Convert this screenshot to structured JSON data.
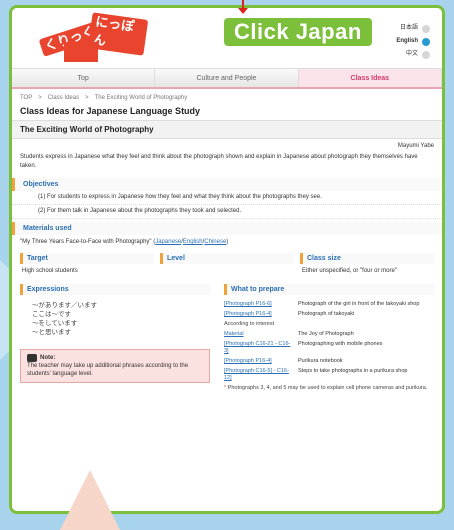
{
  "header": {
    "logo_text_1": "くりっく",
    "logo_text_2": "にっぽん",
    "brand": "Click Japan",
    "languages": [
      {
        "label": "日本語",
        "active": false
      },
      {
        "label": "English",
        "active": true
      },
      {
        "label": "中文",
        "active": false
      }
    ]
  },
  "tabs": [
    {
      "label": "Top",
      "active": false
    },
    {
      "label": "Culture and People",
      "active": false
    },
    {
      "label": "Class Ideas",
      "active": true
    }
  ],
  "breadcrumb": [
    "TOP",
    ">",
    "Class Ideas",
    ">",
    "The Exciting World of Photography"
  ],
  "page_title": "Class Ideas for Japanese Language Study",
  "subtitle": "The Exciting World of Photography",
  "author": "Mayumi Yabe",
  "intro": "Students express in Japanese what they feel and think about the photograph shown and explain in Japanese about photograph they themselves have taken.",
  "objectives": {
    "heading": "Objectives",
    "items": [
      "(1) For students to express in Japanese how they feel and what they think about the photographs they see.",
      "(2) For them talk in Japanese about the photographs they took and selected."
    ]
  },
  "materials": {
    "heading": "Materials used",
    "text": "\"My Three Years Face-to-Face with Photography\" (",
    "links": [
      "Japanese",
      "English",
      "Chinese"
    ],
    "sep": "/",
    "close": ")"
  },
  "target": {
    "heading": "Target",
    "value": "High school students"
  },
  "level": {
    "heading": "Level",
    "value": ""
  },
  "class_size": {
    "heading": "Class size",
    "value": "Either unspecified, or \"four or more\""
  },
  "expressions": {
    "heading": "Expressions",
    "lines": [
      "〜があります／います",
      "ここは〜です",
      "〜をしています",
      "〜と思います"
    ],
    "note_title": "Note:",
    "note_text": "The teacher may take up additional phrases according to the students' language level."
  },
  "prepare": {
    "heading": "What to prepare",
    "rows1": [
      {
        "link": "[Photograph P16-6]",
        "desc": "Photograph of the girl in front of the takoyaki shop"
      },
      {
        "link": "[Photograph P16-4]",
        "desc": "Photograph of takoyaki"
      }
    ],
    "interest": "According to interest",
    "rows2": [
      {
        "link": "Material",
        "desc": "The Joy of Photograph"
      },
      {
        "link": "[Photograph C16-21 - C16-3]",
        "desc": "Photographing with mobile phones"
      },
      {
        "link": "[Photograph P16-4]",
        "desc": "Purikura notebook"
      },
      {
        "link": "[Photograph C16-5] - C16-12]",
        "desc": "Steps to take photographs in a purikura shop"
      }
    ],
    "footnote_mark": "*",
    "footnote": "Photographs 3, 4, and 5 may be used to explain cell phone cameras and purikura."
  },
  "colors": {
    "green": "#7cbf3a",
    "blue": "#2a6fb5",
    "orange": "#f0a33a",
    "pink": "#d23b6a"
  }
}
